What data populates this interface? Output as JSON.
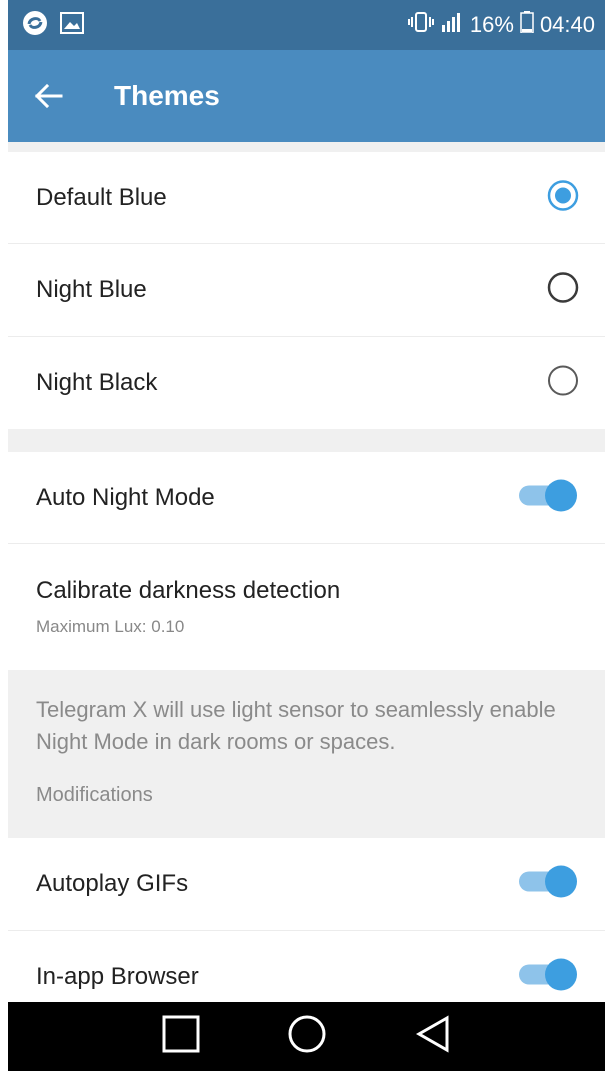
{
  "status_bar": {
    "battery": "16%",
    "time": "04:40"
  },
  "app_bar": {
    "title": "Themes"
  },
  "themes": [
    {
      "label": "Default Blue",
      "selected": true
    },
    {
      "label": "Night Blue",
      "selected": false
    },
    {
      "label": "Night Black",
      "selected": false
    }
  ],
  "night_mode": {
    "auto_label": "Auto Night Mode",
    "auto_enabled": true,
    "calibrate_label": "Calibrate darkness detection",
    "calibrate_sub": "Maximum Lux: 0.10"
  },
  "info_text": "Telegram X will use light sensor to seamlessly enable Night Mode in dark rooms or spaces.",
  "modifications": {
    "header": "Modifications",
    "items": [
      {
        "label": "Autoplay GIFs",
        "enabled": true
      },
      {
        "label": "In-app Browser",
        "enabled": true
      }
    ]
  },
  "colors": {
    "status_bar": "#3a6f9a",
    "app_bar": "#4a8bbf",
    "accent": "#3d9ee0",
    "toggle_track": "#8ec3ea"
  }
}
